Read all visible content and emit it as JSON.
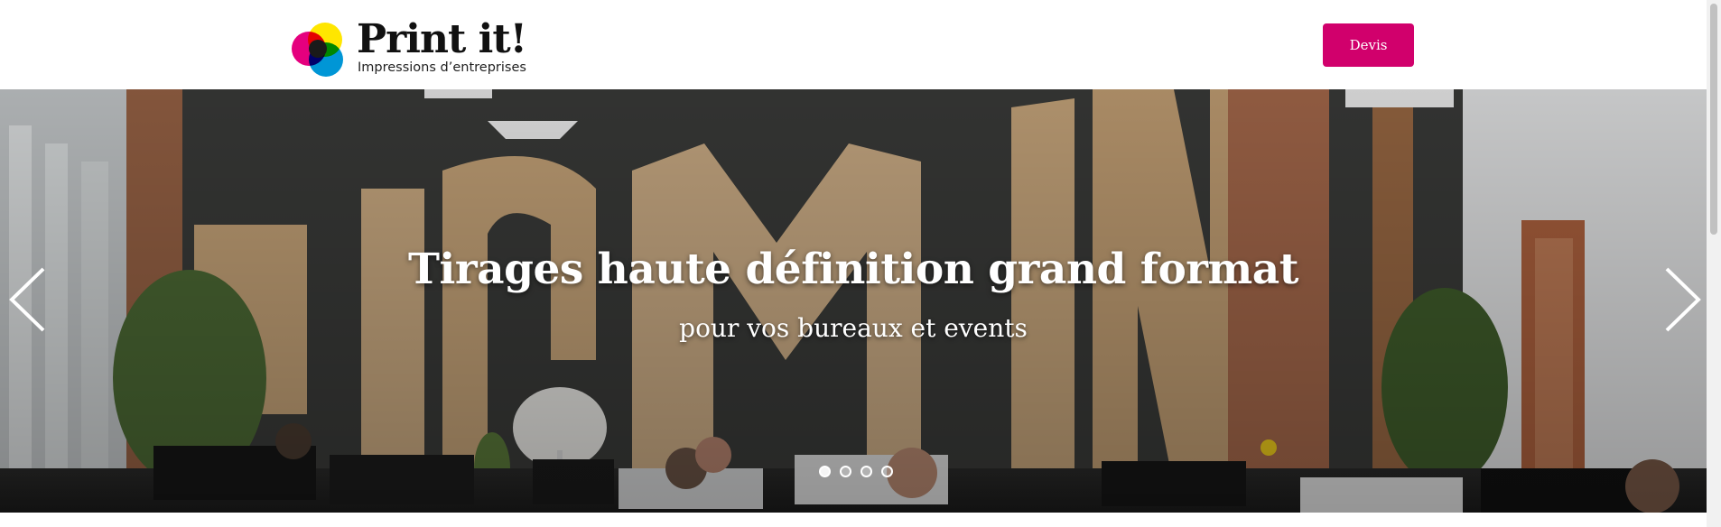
{
  "header": {
    "logo_title": "Print it!",
    "logo_subtitle": "Impressions d’entreprises",
    "devis_label": "Devis"
  },
  "hero": {
    "title": "Tirages haute définition grand format",
    "subtitle": "pour vos bureaux et events",
    "prev_icon": "chevron-left-icon",
    "next_icon": "chevron-right-icon",
    "slide_count": 4,
    "active_slide": 1
  },
  "colors": {
    "accent": "#d1006c",
    "logo_yellow": "#ffe600",
    "logo_magenta": "#e5007e",
    "logo_cyan": "#0096d6",
    "logo_black": "#1a1a1a"
  }
}
